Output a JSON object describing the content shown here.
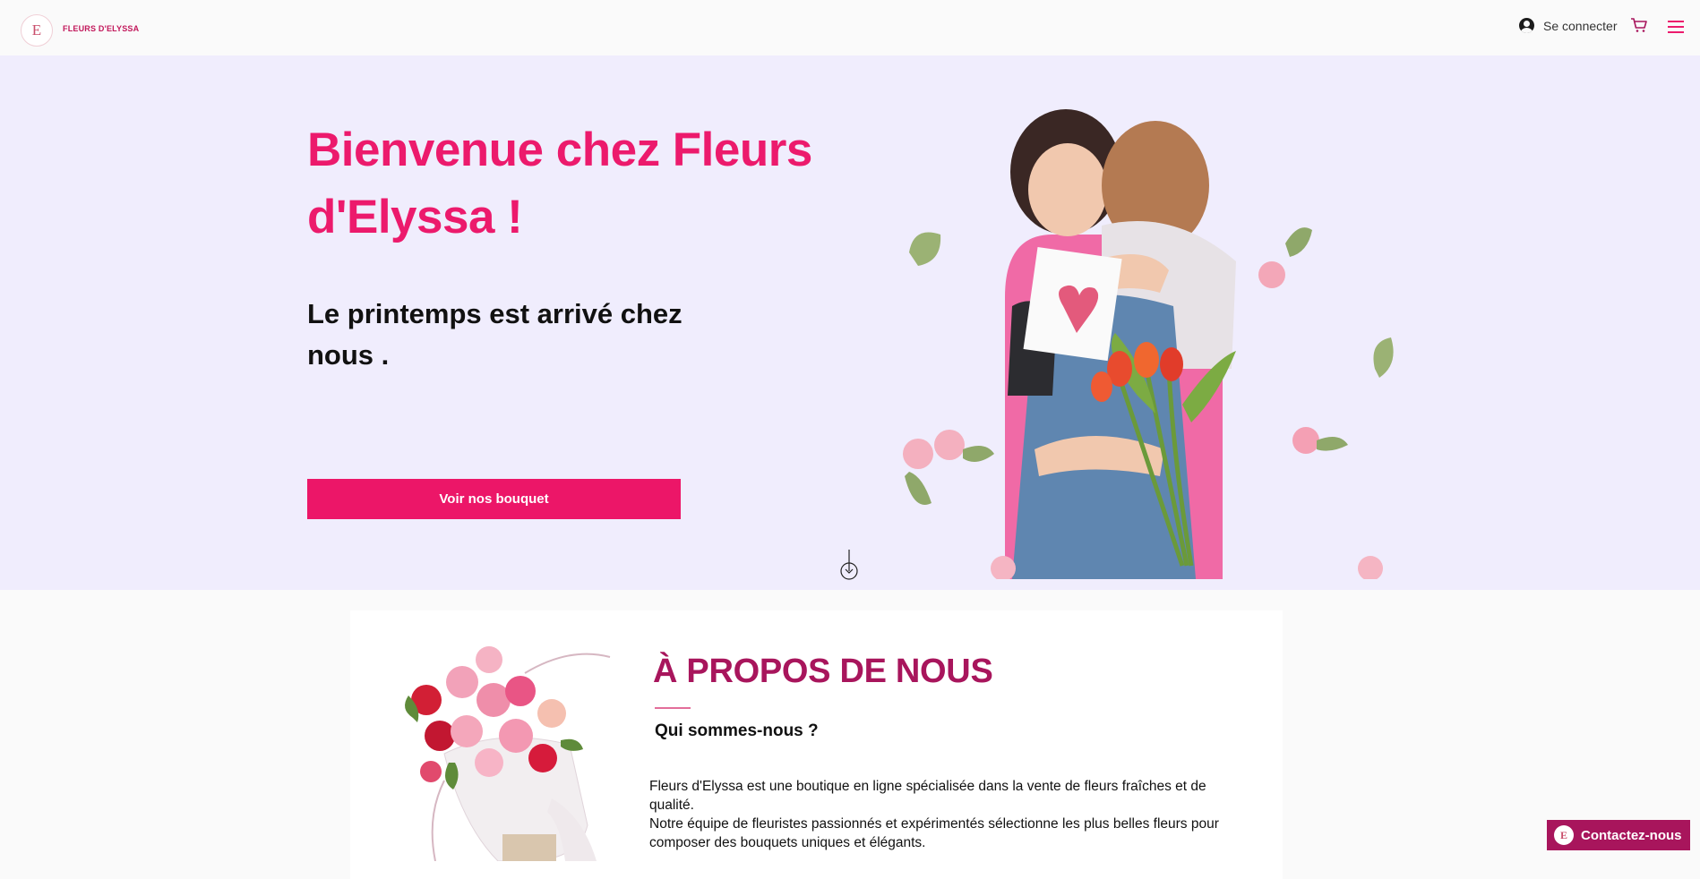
{
  "header": {
    "logo_letter": "E",
    "brand_name": "FLEURS D'ELYSSA",
    "login_label": "Se connecter"
  },
  "hero": {
    "title": "Bienvenue chez Fleurs d'Elyssa !",
    "subtitle": "Le printemps est arrivé chez nous .",
    "cta_label": "Voir nos bouquet"
  },
  "about": {
    "title": "À PROPOS DE NOUS",
    "subtitle": "Qui sommes-nous ?",
    "paragraph_1": "Fleurs d'Elyssa est une boutique en ligne spécialisée dans la vente de fleurs fraîches et de qualité.",
    "paragraph_2": "Notre équipe de fleuristes passionnés et expérimentés sélectionne les plus belles fleurs pour composer des bouquets uniques et élégants."
  },
  "contact": {
    "logo_letter": "E",
    "label": "Contactez-nous"
  },
  "colors": {
    "accent_pink": "#ec1a6c",
    "brand_magenta": "#a8155c",
    "hero_background": "#f0edfd",
    "page_background": "#fafafa"
  },
  "icons": {
    "user": "user-icon",
    "cart": "cart-icon",
    "menu": "menu-icon",
    "scroll": "scroll-down-icon"
  }
}
